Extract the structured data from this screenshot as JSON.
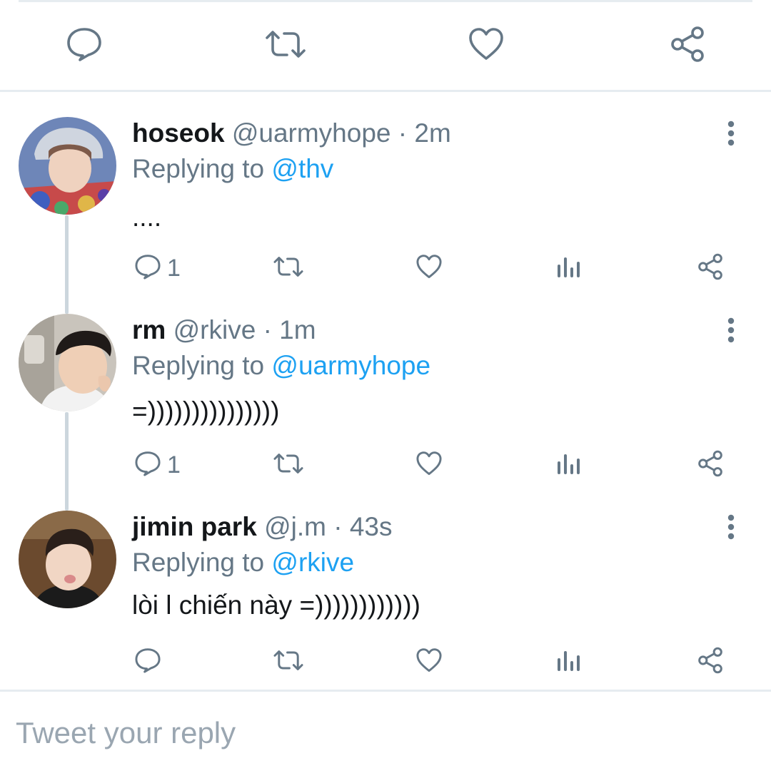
{
  "tweets": [
    {
      "name": "hoseok",
      "handle": "@uarmyhope",
      "time": "· 2m",
      "replying_prefix": "Replying to",
      "replying_to": "@thv",
      "text": "....",
      "reply_count": "1"
    },
    {
      "name": "rm",
      "handle": "@rkive",
      "time": "· 1m",
      "replying_prefix": "Replying to",
      "replying_to": "@uarmyhope",
      "text": "=)))))))))))))))",
      "reply_count": "1"
    },
    {
      "name": "jimin park",
      "handle": "@j.m",
      "time": "· 43s",
      "replying_prefix": "Replying to",
      "replying_to": "@rkive",
      "text": "lòi l chiến này =))))))))))))",
      "reply_count": ""
    }
  ],
  "reply_box": {
    "placeholder": "Tweet your reply"
  },
  "icons": {
    "main_actions": [
      "reply-icon",
      "retweet-icon",
      "like-icon",
      "share-icon"
    ],
    "tweet_actions": [
      "reply-icon",
      "retweet-icon",
      "like-icon",
      "analytics-icon",
      "share-icon"
    ],
    "menu": "more-vertical-icon"
  },
  "colors": {
    "icon": "#657786",
    "link": "#1da1f2",
    "divider": "#e6ecf0",
    "thread_line": "#ccd6dd",
    "text": "#14171a"
  }
}
